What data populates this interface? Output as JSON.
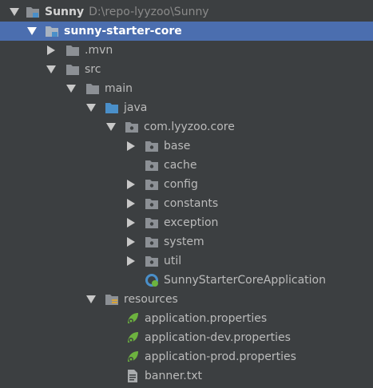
{
  "project_tree": {
    "root": {
      "label": "Sunny",
      "path": "D:\\repo-lyyzoo\\Sunny"
    },
    "module": {
      "label": "sunny-starter-core"
    },
    "items": [
      {
        "label": ".mvn"
      },
      {
        "label": "src"
      },
      {
        "label": "main"
      },
      {
        "label": "java"
      },
      {
        "label": "com.lyyzoo.core"
      },
      {
        "label": "base"
      },
      {
        "label": "cache"
      },
      {
        "label": "config"
      },
      {
        "label": "constants"
      },
      {
        "label": "exception"
      },
      {
        "label": "system"
      },
      {
        "label": "util"
      },
      {
        "label": "SunnyStarterCoreApplication"
      },
      {
        "label": "resources"
      },
      {
        "label": "application.properties"
      },
      {
        "label": "application-dev.properties"
      },
      {
        "label": "application-prod.properties"
      },
      {
        "label": "banner.txt"
      }
    ]
  },
  "colors": {
    "background": "#3c3f41",
    "selection": "#4b6eaf",
    "folder": "#8c9095",
    "source_folder": "#4a8fc9",
    "spring_green": "#6db33f"
  },
  "icons": {
    "folder": "folder-icon",
    "module": "module-folder-icon",
    "source_folder": "source-folder-icon",
    "package": "package-icon",
    "resources": "resources-folder-icon",
    "spring_app": "spring-boot-class-icon",
    "spring_props": "spring-properties-icon",
    "text_file": "text-file-icon"
  }
}
